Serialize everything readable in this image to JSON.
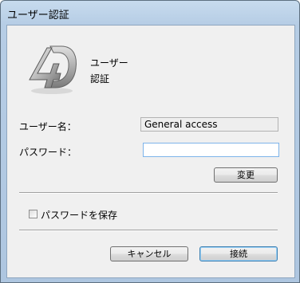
{
  "window": {
    "title": "ユーザー認証"
  },
  "logo": {
    "text": "4D",
    "caption_line1": "ユーザー",
    "caption_line2": "認証"
  },
  "form": {
    "username_label": "ユーザー名：",
    "username_value": "General access",
    "password_label": "パスワード：",
    "password_value": "",
    "change_button": "変更",
    "save_password_label": "パスワードを保存",
    "save_password_checked": false
  },
  "buttons": {
    "cancel": "キャンセル",
    "connect": "接続"
  }
}
